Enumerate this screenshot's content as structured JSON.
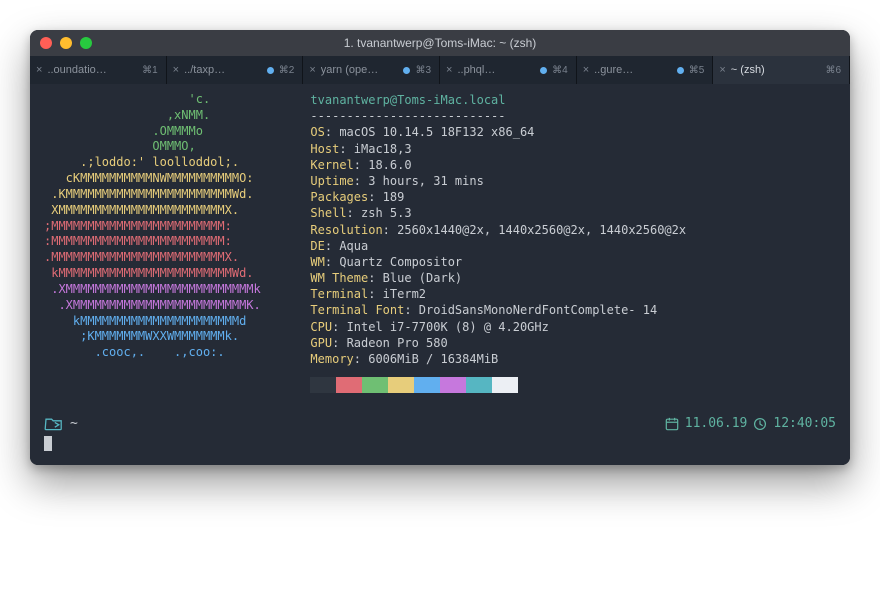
{
  "window": {
    "title": "1. tvanantwerp@Toms-iMac: ~ (zsh)"
  },
  "tabs": [
    {
      "label": "..oundatio…",
      "shortcut": "⌘1",
      "dot": "",
      "active": false
    },
    {
      "label": "../taxp…",
      "shortcut": "⌘2",
      "dot": "#61afef",
      "active": false
    },
    {
      "label": "yarn (ope…",
      "shortcut": "⌘3",
      "dot": "#61afef",
      "active": false
    },
    {
      "label": "..phql…",
      "shortcut": "⌘4",
      "dot": "#61afef",
      "active": false
    },
    {
      "label": "..gure…",
      "shortcut": "⌘5",
      "dot": "#61afef",
      "active": false
    },
    {
      "label": "~ (zsh)",
      "shortcut": "⌘6",
      "dot": "",
      "active": true
    }
  ],
  "neofetch": {
    "host_line": "tvanantwerp@Toms-iMac.local",
    "dashes": "---------------------------",
    "rows": [
      {
        "k": "OS",
        "v": "macOS 10.14.5 18F132 x86_64"
      },
      {
        "k": "Host",
        "v": "iMac18,3"
      },
      {
        "k": "Kernel",
        "v": "18.6.0"
      },
      {
        "k": "Uptime",
        "v": "3 hours, 31 mins"
      },
      {
        "k": "Packages",
        "v": "189"
      },
      {
        "k": "Shell",
        "v": "zsh 5.3"
      },
      {
        "k": "Resolution",
        "v": "2560x1440@2x, 1440x2560@2x, 1440x2560@2x"
      },
      {
        "k": "DE",
        "v": "Aqua"
      },
      {
        "k": "WM",
        "v": "Quartz Compositor"
      },
      {
        "k": "WM Theme",
        "v": "Blue (Dark)"
      },
      {
        "k": "Terminal",
        "v": "iTerm2"
      },
      {
        "k": "Terminal Font",
        "v": "DroidSansMonoNerdFontComplete- 14"
      },
      {
        "k": "CPU",
        "v": "Intel i7-7700K (8) @ 4.20GHz"
      },
      {
        "k": "GPU",
        "v": "Radeon Pro 580"
      },
      {
        "k": "Memory",
        "v": "6006MiB / 16384MiB"
      }
    ],
    "swatches": [
      "#2f3640",
      "#e06c75",
      "#6fbf73",
      "#e7cd7b",
      "#61afef",
      "#c678dd",
      "#56b6c2",
      "#eceff4"
    ],
    "ascii": [
      {
        "c": "c-g",
        "t": "                    'c.          "
      },
      {
        "c": "c-g",
        "t": "                 ,xNMM.          "
      },
      {
        "c": "c-g",
        "t": "               .OMMMMo           "
      },
      {
        "c": "c-g",
        "t": "               OMMMO,            "
      },
      {
        "c": "c-y",
        "t": "     .;loddo:' loolloddol;.      "
      },
      {
        "c": "c-y",
        "t": "   cKMMMMMMMMMMNWMMMMMMMMMMO:    "
      },
      {
        "c": "c-y",
        "t": " .KMMMMMMMMMMMMMMMMMMMMMMMWd.    "
      },
      {
        "c": "c-y",
        "t": " XMMMMMMMMMMMMMMMMMMMMMMMX.      "
      },
      {
        "c": "c-r",
        "t": ";MMMMMMMMMMMMMMMMMMMMMMMM:       "
      },
      {
        "c": "c-r",
        "t": ":MMMMMMMMMMMMMMMMMMMMMMMM:       "
      },
      {
        "c": "c-r",
        "t": ".MMMMMMMMMMMMMMMMMMMMMMMMX.      "
      },
      {
        "c": "c-r",
        "t": " kMMMMMMMMMMMMMMMMMMMMMMMMWd.    "
      },
      {
        "c": "c-m",
        "t": " .XMMMMMMMMMMMMMMMMMMMMMMMMMMk   "
      },
      {
        "c": "c-m",
        "t": "  .XMMMMMMMMMMMMMMMMMMMMMMMMK.   "
      },
      {
        "c": "c-b",
        "t": "    kMMMMMMMMMMMMMMMMMMMMMMd     "
      },
      {
        "c": "c-b",
        "t": "     ;KMMMMMMMWXXWMMMMMMMk.      "
      },
      {
        "c": "c-b",
        "t": "       .cooc,.    .,coo:.        "
      }
    ]
  },
  "status": {
    "cwd": "~",
    "date": "11.06.19",
    "time": "12:40:05"
  }
}
